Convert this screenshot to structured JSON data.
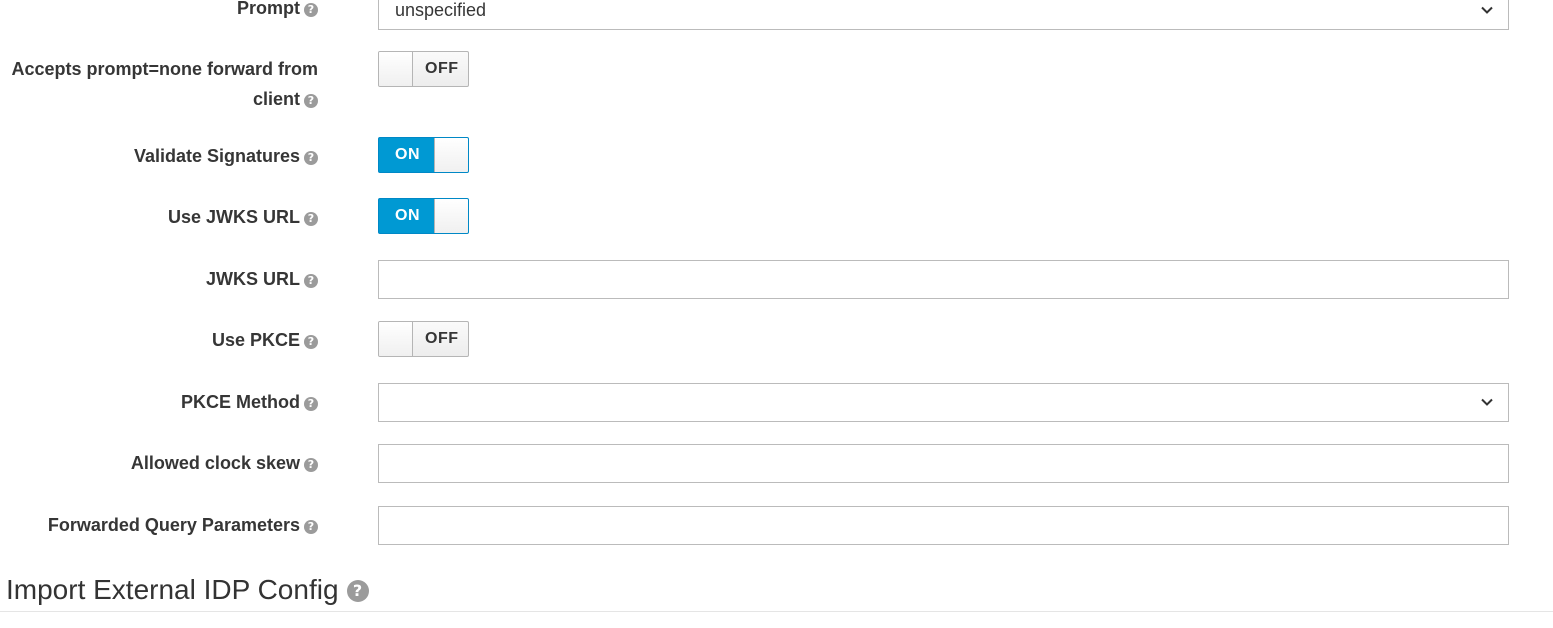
{
  "fields": {
    "prompt": {
      "label": "Prompt",
      "value": "unspecified"
    },
    "accepts_prompt_none": {
      "label": "Accepts prompt=none forward from client",
      "state": "OFF"
    },
    "validate_signatures": {
      "label": "Validate Signatures",
      "state": "ON"
    },
    "use_jwks_url": {
      "label": "Use JWKS URL",
      "state": "ON"
    },
    "jwks_url": {
      "label": "JWKS URL",
      "value": ""
    },
    "use_pkce": {
      "label": "Use PKCE",
      "state": "OFF"
    },
    "pkce_method": {
      "label": "PKCE Method",
      "value": ""
    },
    "allowed_clock_skew": {
      "label": "Allowed clock skew",
      "value": ""
    },
    "forwarded_query_parameters": {
      "label": "Forwarded Query Parameters",
      "value": ""
    }
  },
  "help_glyph": "?",
  "section": {
    "title": "Import External IDP Config"
  },
  "colors": {
    "toggle_on": "#0099d3",
    "help_icon": "#9b9b9b"
  }
}
